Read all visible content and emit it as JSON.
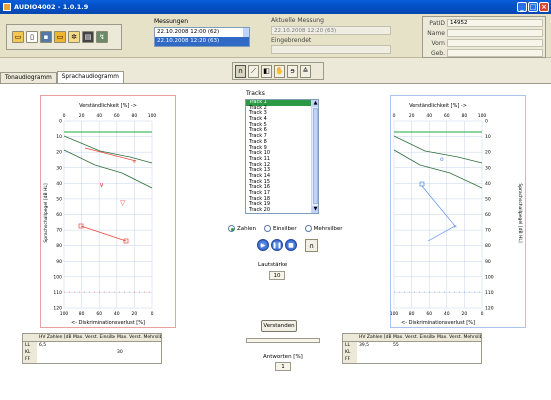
{
  "window": {
    "title": "AUDIO4002 - 1.0.1.9",
    "min_label": "_",
    "max_label": "□",
    "close_label": "×"
  },
  "toolbar": {
    "icons": [
      "folder-icon",
      "new-document-icon",
      "save-icon",
      "open-folder-icon",
      "settings-icon",
      "printer-icon",
      "network-icon"
    ]
  },
  "messungen": {
    "label": "Messungen",
    "items": [
      "22.10.2008 12:00 (62)",
      "22.10.2008 12:20 (63)"
    ],
    "selected_index": 1
  },
  "aktuell": {
    "label": "Aktuelle Messung",
    "value": "22.10.2008 12:20 (63)",
    "eingebunden_label": "Eingebrendet"
  },
  "patient": {
    "pat_id_label": "PatID",
    "pat_id_value": "14952",
    "name_label": "Name",
    "vorn_label": "Vorn",
    "geb_label": "Geb."
  },
  "mode_bar": {
    "icons": [
      "headphones-icon",
      "bone-conduction-icon",
      "speaker-icon",
      "hand-icon",
      "ear-icon",
      "volume-icon"
    ],
    "active_index": 0
  },
  "tabs": [
    {
      "label": "Tonaudiogramm",
      "active": false
    },
    {
      "label": "Sprachaudiogramm",
      "active": true
    }
  ],
  "audiogram_left": {
    "x_top_title": "Verständlichkeit [%] ->",
    "x_bottom_title": "<- Diskriminationsverlust [%]",
    "y_title": "Sprachschallpegel [dB HL]",
    "x_top_ticks": [
      "0",
      "20",
      "40",
      "60",
      "80",
      "100"
    ],
    "x_bottom_ticks": [
      "100",
      "80",
      "60",
      "40",
      "20",
      "0"
    ],
    "y_ticks": [
      "0",
      "10",
      "20",
      "30",
      "40",
      "50",
      "60",
      "70",
      "80",
      "90",
      "100",
      "110",
      "120"
    ],
    "accent": "#e8473a"
  },
  "audiogram_right": {
    "x_top_title": "Verständlichkeit [%] ->",
    "x_bottom_title": "<- Diskriminationsverlust [%]",
    "y_title": "Sprachschallpegel [dB HL]",
    "x_top_ticks": [
      "0",
      "20",
      "40",
      "60",
      "80",
      "100"
    ],
    "x_bottom_ticks": [
      "100",
      "80",
      "60",
      "40",
      "20",
      "0"
    ],
    "y_ticks": [
      "0",
      "10",
      "20",
      "30",
      "40",
      "50",
      "60",
      "70",
      "80",
      "90",
      "100",
      "110",
      "120"
    ],
    "accent": "#4a86e8"
  },
  "tracks": {
    "label": "Tracks",
    "items": [
      "Track 1",
      "Track 2",
      "Track 3",
      "Track 4",
      "Track 5",
      "Track 6",
      "Track 7",
      "Track 8",
      "Track 9",
      "Track 10",
      "Track 11",
      "Track 12",
      "Track 13",
      "Track 14",
      "Track 15",
      "Track 16",
      "Track 17",
      "Track 18",
      "Track 19",
      "Track 20"
    ],
    "selected_index": 0
  },
  "mode_radios": [
    {
      "label": "Zahlen",
      "checked": true
    },
    {
      "label": "Einsilber",
      "checked": false
    },
    {
      "label": "Mehrsilber",
      "checked": false
    }
  ],
  "playback": {
    "play": "▶",
    "pause": "❚❚",
    "stop": "■",
    "headphone": "∩"
  },
  "lautstaerke": {
    "label": "Lautstärke",
    "value": "10"
  },
  "verstanden": {
    "label": "Verstanden"
  },
  "antworten": {
    "label": "Antworten [%]",
    "value": "1"
  },
  "table_left": {
    "headers": [
      "",
      "HV Zahlen [dB]",
      "Max. Verst. Einsilber [%]",
      "Max. Verst. Mehrsilber [%]"
    ],
    "rows": [
      [
        "LL",
        "6,5",
        "",
        ""
      ],
      [
        "KL",
        "",
        "",
        "30"
      ],
      [
        "FF",
        "",
        "",
        ""
      ]
    ]
  },
  "table_right": {
    "headers": [
      "",
      "HV Zahlen [dB]",
      "Max. Verst. Einsilber [%]",
      "Max. Verst. Mehrsilber [%]"
    ],
    "rows": [
      [
        "LL",
        "39,5",
        "55",
        ""
      ],
      [
        "KL",
        "",
        "",
        ""
      ],
      [
        "FF",
        "",
        "",
        ""
      ]
    ]
  }
}
